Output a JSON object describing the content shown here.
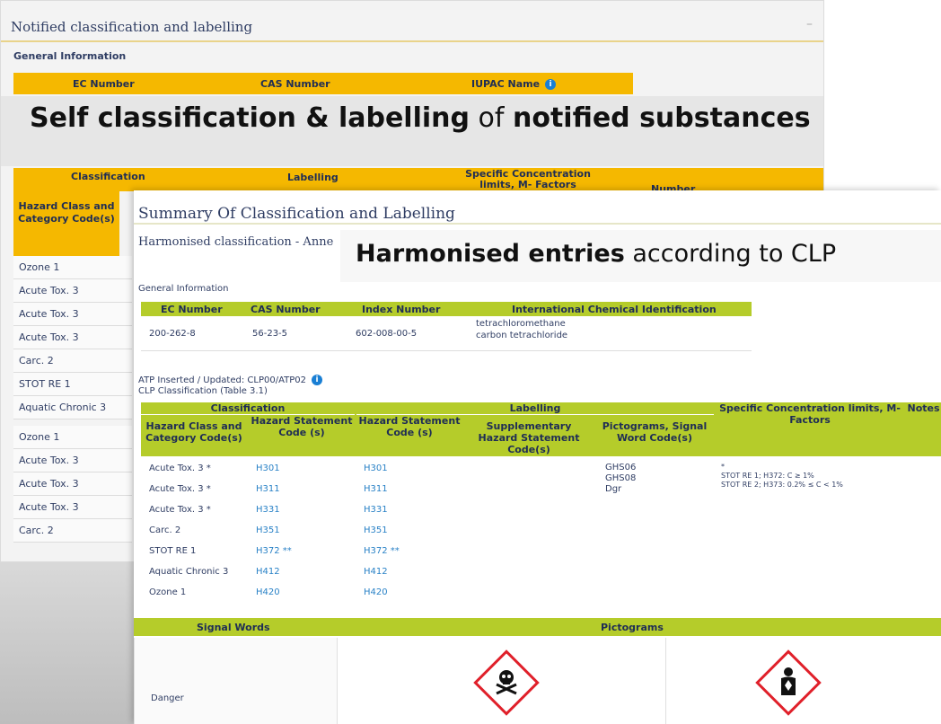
{
  "background_page": {
    "title": "Notified classification and labelling",
    "general_information": "General Information",
    "id_columns": [
      "EC Number",
      "CAS Number",
      "IUPAC Name"
    ],
    "banner_bold_1": "Self classification & labelling",
    "banner_normal": " of ",
    "banner_bold_2": "notified substances",
    "classification_header": "Classification",
    "labelling_header": "Labelling",
    "scl_header": "Specific Concentration limits, M- Factors",
    "number_header": "Number",
    "hazard_header": "Hazard Class and Category Code(s)",
    "rows_group_1": [
      "Ozone 1",
      "Acute Tox. 3",
      "Acute Tox. 3",
      "Acute Tox. 3",
      "Carc. 2",
      "STOT RE 1",
      "Aquatic Chronic 3"
    ],
    "rows_group_2": [
      "Ozone 1",
      "Acute Tox. 3",
      "Acute Tox. 3",
      "Acute Tox. 3",
      "Carc. 2"
    ]
  },
  "summary_page": {
    "title": "Summary Of Classification and Labelling",
    "subtitle": "Harmonised classification - Anne",
    "banner_bold": "Harmonised entries",
    "banner_normal": " according to CLP",
    "general_information": "General Information",
    "id_table": {
      "headers": [
        "EC Number",
        "CAS Number",
        "Index Number",
        "International Chemical Identification"
      ],
      "ec": "200-262-8",
      "cas": "56-23-5",
      "index": "602-008-00-5",
      "name_line_1": "tetrachloromethane",
      "name_line_2": "carbon tetrachloride"
    },
    "atp_label": "ATP Inserted / Updated:  CLP00/ATP02",
    "clp_label": "CLP Classification (Table 3.1)",
    "clp_headers": {
      "classification": "Classification",
      "labelling": "Labelling",
      "scl": "Specific Concentration limits, M-Factors",
      "notes": "Notes",
      "hazard_class": "Hazard Class and Category Code(s)",
      "hazard_statement_1": "Hazard Statement Code (s)",
      "hazard_statement_2": "Hazard Statement Code (s)",
      "supplementary": "Supplementary Hazard Statement Code(s)",
      "pictograms": "Pictograms, Signal Word Code(s)"
    },
    "clp_rows": [
      {
        "hazard": "Acute Tox. 3 *",
        "h1": "H301",
        "h2": "H301"
      },
      {
        "hazard": "Acute Tox. 3 *",
        "h1": "H311",
        "h2": "H311"
      },
      {
        "hazard": "Acute Tox. 3 *",
        "h1": "H331",
        "h2": "H331"
      },
      {
        "hazard": "Carc. 2",
        "h1": "H351",
        "h2": "H351"
      },
      {
        "hazard": "STOT RE 1",
        "h1": "H372 **",
        "h2": "H372 **"
      },
      {
        "hazard": "Aquatic Chronic 3",
        "h1": "H412",
        "h2": "H412"
      },
      {
        "hazard": "Ozone 1",
        "h1": "H420",
        "h2": "H420"
      }
    ],
    "pictogram_codes": [
      "GHS06",
      "GHS08",
      "Dgr"
    ],
    "scl_values": [
      "*",
      "STOT RE 1; H372: C ≥ 1%",
      "STOT RE 2; H373: 0.2% ≤ C < 1%"
    ],
    "signal_words_header": "Signal Words",
    "pictograms_header": "Pictograms",
    "signal_word": "Danger",
    "pictogram_icons": [
      "skull-and-crossbones-icon",
      "health-hazard-icon"
    ]
  },
  "colors": {
    "orange_header": "#f5b800",
    "green_header": "#b5cc2a",
    "link_blue": "#2a82c7",
    "ghs_red": "#e0202a"
  }
}
